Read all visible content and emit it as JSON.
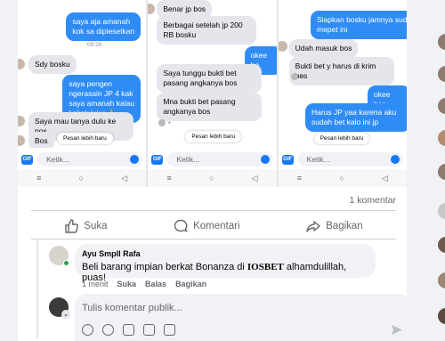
{
  "screenshots": {
    "left": {
      "messages": [
        {
          "dir": "out",
          "text": "saya aja amanah kok sa diplesetkan"
        },
        {
          "dir": "in",
          "text": "Sdy bosku"
        },
        {
          "dir": "out",
          "text": "saya pengen ngerasain JP 4 kak saya amanah kalau kakak jujur 🙏"
        },
        {
          "dir": "in",
          "text": "Saya mau tanya dulu ke nos"
        },
        {
          "dir": "in",
          "text": "Bos"
        }
      ],
      "timestamp": "09:26",
      "pill": "Pesan lebih baru",
      "input_placeholder": "Ketik..."
    },
    "middle": {
      "messages": [
        {
          "dir": "in",
          "text": "Benar jp bos"
        },
        {
          "dir": "in",
          "text": "Berbagai setelah jp 200 RB bosku"
        },
        {
          "dir": "out",
          "text": "okee bo"
        },
        {
          "dir": "in",
          "text": "Saya tunggu bukti bet pasang angkanya bos"
        },
        {
          "dir": "in",
          "text": "Mna bukti bet pasang angkanya bos"
        }
      ],
      "pill": "Pesan lebih baru",
      "input_placeholder": "Ketik..."
    },
    "right": {
      "messages": [
        {
          "dir": "out",
          "text": "Siapkan bosku jamnya sud mepet ini"
        },
        {
          "dir": "in",
          "text": "Udah masuk bos"
        },
        {
          "dir": "in",
          "text": "Bukti bet y harus di krim bos"
        },
        {
          "dir": "out",
          "text": "okee bos"
        },
        {
          "dir": "out",
          "text": "Harus JP yaa karena aku sudah bet kalo ini jp"
        }
      ],
      "pill": "Pesan lebih baru",
      "input_placeholder": "Ketik..."
    },
    "nav": [
      "≡",
      "○",
      "◁"
    ],
    "gif_label": "GIF"
  },
  "post": {
    "comment_count": "1 komentar",
    "actions": {
      "like": "Suka",
      "comment": "Komentari",
      "share": "Bagikan"
    }
  },
  "comment": {
    "author": "Ayu Smpll Rafa",
    "text_before": "Beli barang impian berkat Bonanza di ",
    "text_brand": "IOSBET",
    "text_after": " alhamdulillah, puas!",
    "time": "1 menit",
    "like": "Suka",
    "reply": "Balas",
    "share": "Bagikan"
  },
  "reply_box": {
    "placeholder": "Tulis komentar publik..."
  },
  "colors": {
    "accent": "#1877f2",
    "out_bubble": "#2f8cf5",
    "in_bubble": "#e4e6eb"
  }
}
